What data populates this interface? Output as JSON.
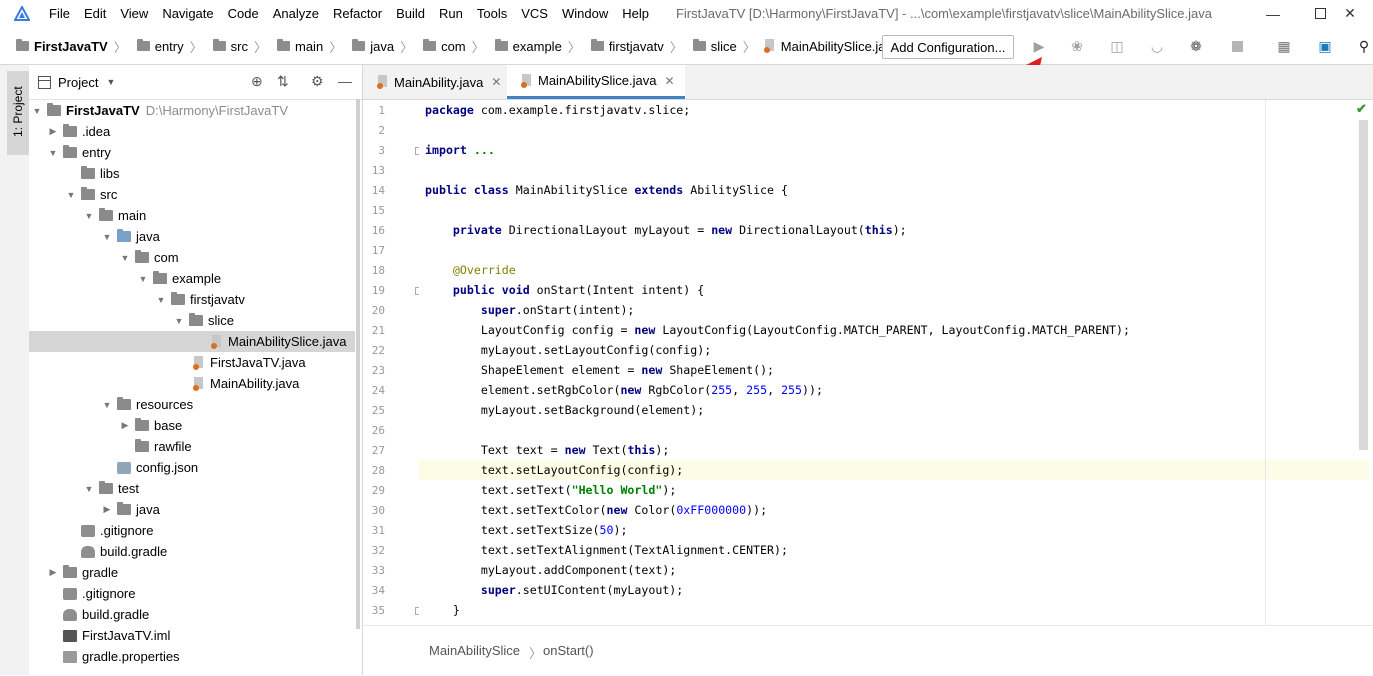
{
  "menubar": {
    "items": [
      "File",
      "Edit",
      "View",
      "Navigate",
      "Code",
      "Analyze",
      "Refactor",
      "Build",
      "Run",
      "Tools",
      "VCS",
      "Window",
      "Help"
    ],
    "title": "FirstJavaTV [D:\\Harmony\\FirstJavaTV] - ...\\com\\example\\firstjavatv\\slice\\MainAbilitySlice.java"
  },
  "navbar": {
    "project": "FirstJavaTV",
    "crumbs": [
      "entry",
      "src",
      "main",
      "java",
      "com",
      "example",
      "firstjavatv",
      "slice"
    ],
    "file": "MainAbilitySlice.java",
    "add_configuration": "Add Configuration..."
  },
  "left_stripe": {
    "project_tab": "1: Project"
  },
  "project_panel": {
    "title": "Project",
    "root_name": "FirstJavaTV",
    "root_path": "D:\\Harmony\\FirstJavaTV",
    "rows": [
      ".idea",
      "entry",
      "libs",
      "src",
      "main",
      "java",
      "com",
      "example",
      "firstjavatv",
      "slice",
      "MainAbilitySlice.java",
      "FirstJavaTV.java",
      "MainAbility.java",
      "resources",
      "base",
      "rawfile",
      "config.json",
      "test",
      "java",
      ".gitignore",
      "build.gradle",
      "gradle",
      ".gitignore",
      "build.gradle",
      "FirstJavaTV.iml",
      "gradle.properties"
    ]
  },
  "editor": {
    "tabs": [
      "MainAbility.java",
      "MainAbilitySlice.java"
    ],
    "line_numbers": [
      "1",
      "2",
      "3",
      "13",
      "14",
      "15",
      "16",
      "17",
      "18",
      "19",
      "20",
      "21",
      "22",
      "23",
      "24",
      "25",
      "26",
      "27",
      "28",
      "29",
      "30",
      "31",
      "32",
      "33",
      "34",
      "35"
    ],
    "breadcrumb": [
      "MainAbilitySlice",
      "onStart()"
    ]
  },
  "colors": {
    "keyword": "#000080",
    "string": "#008000",
    "number": "#0000ff",
    "annotation": "#808000",
    "arrow": "#e02020"
  }
}
